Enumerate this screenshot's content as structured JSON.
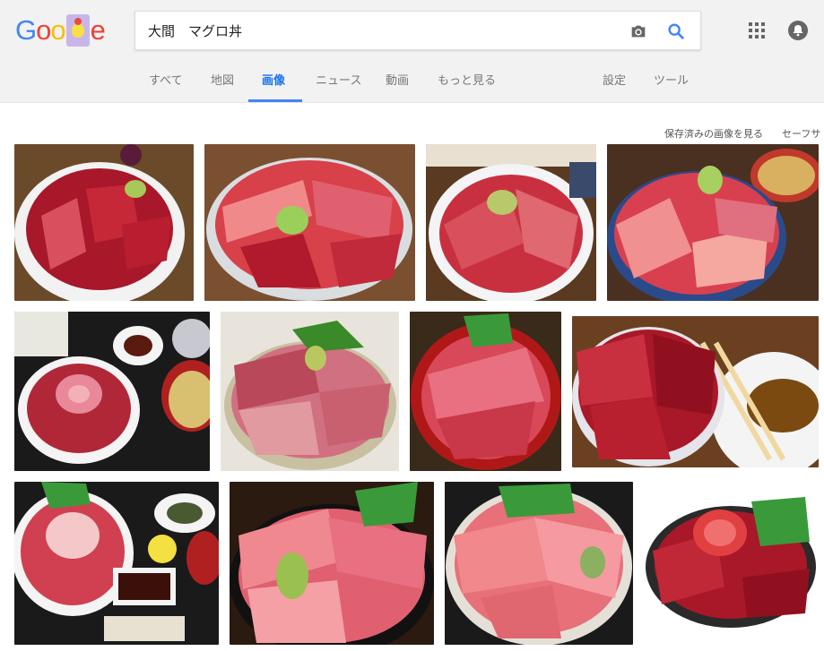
{
  "logo": {
    "letters": [
      "G",
      "o",
      "o",
      "e"
    ]
  },
  "search": {
    "query": "大間　マグロ丼"
  },
  "tabs": [
    {
      "label": "すべて"
    },
    {
      "label": "地図"
    },
    {
      "label": "画像"
    },
    {
      "label": "ニュース"
    },
    {
      "label": "動画"
    },
    {
      "label": "もっと見る"
    },
    {
      "label": "設定"
    },
    {
      "label": "ツール"
    }
  ],
  "filters": {
    "saved_images": "保存済みの画像を見る",
    "safesearch": "セーフサ"
  },
  "icons": {
    "camera": "camera-icon",
    "search": "search-icon",
    "apps": "apps-grid-icon",
    "notifications": "bell-icon"
  },
  "colors": {
    "accent": "#4285f4",
    "active_tab": "#1a73e8",
    "header_bg": "#f2f2f2"
  },
  "image_results": {
    "row1": [
      "bowl-lean-tuna",
      "bowl-toro-wasabi",
      "bowl-otoro-slices",
      "bowl-tuna-miso"
    ],
    "row2": [
      "tray-set-rose",
      "bowl-shiso-slices",
      "red-bowl-toro",
      "bowl-chopsticks"
    ],
    "row3": [
      "bowl-set-tray",
      "bowl-otoro-shiso",
      "bowl-toro-close",
      "bowl-rose-shiso"
    ]
  }
}
